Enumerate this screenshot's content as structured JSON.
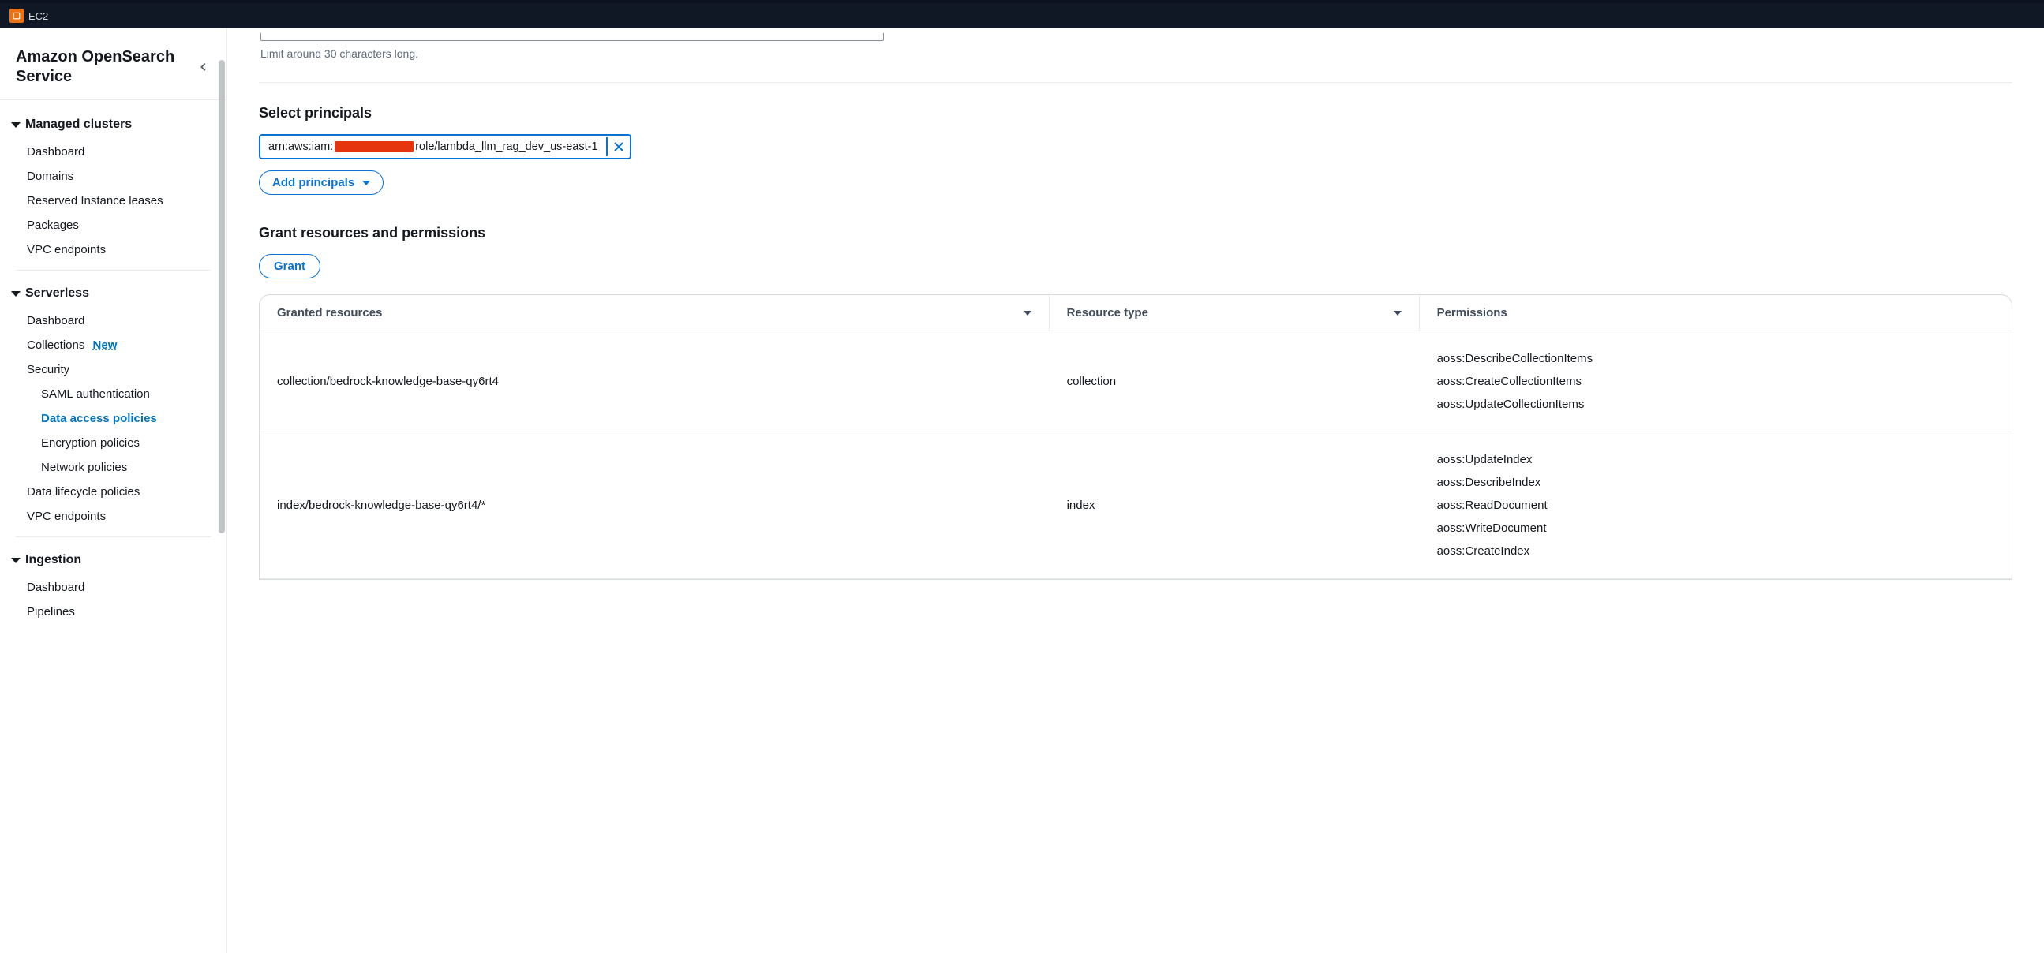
{
  "topbar": {
    "service_label": "EC2"
  },
  "sidebar": {
    "title": "Amazon OpenSearch Service",
    "groups": [
      {
        "label": "Managed clusters",
        "items": [
          {
            "label": "Dashboard"
          },
          {
            "label": "Domains"
          },
          {
            "label": "Reserved Instance leases"
          },
          {
            "label": "Packages"
          },
          {
            "label": "VPC endpoints"
          }
        ]
      },
      {
        "label": "Serverless",
        "items": [
          {
            "label": "Dashboard"
          },
          {
            "label": "Collections",
            "badge": "New"
          },
          {
            "label": "Security",
            "children": [
              {
                "label": "SAML authentication"
              },
              {
                "label": "Data access policies",
                "active": true
              },
              {
                "label": "Encryption policies"
              },
              {
                "label": "Network policies"
              }
            ]
          },
          {
            "label": "Data lifecycle policies"
          },
          {
            "label": "VPC endpoints"
          }
        ]
      },
      {
        "label": "Ingestion",
        "items": [
          {
            "label": "Dashboard"
          },
          {
            "label": "Pipelines"
          }
        ]
      }
    ]
  },
  "main": {
    "char_limit_hint": "Limit around 30 characters long.",
    "principals_heading": "Select principals",
    "principal_token_prefix": "arn:aws:iam:",
    "principal_token_suffix": "role/lambda_llm_rag_dev_us-east-1",
    "add_principals_label": "Add principals",
    "grant_heading": "Grant resources and permissions",
    "grant_btn_label": "Grant",
    "table": {
      "headers": {
        "resources": "Granted resources",
        "type": "Resource type",
        "perms": "Permissions"
      },
      "rows": [
        {
          "resource": "collection/bedrock-knowledge-base-qy6rt4",
          "type": "collection",
          "permissions": [
            "aoss:DescribeCollectionItems",
            "aoss:CreateCollectionItems",
            "aoss:UpdateCollectionItems"
          ]
        },
        {
          "resource": "index/bedrock-knowledge-base-qy6rt4/*",
          "type": "index",
          "permissions": [
            "aoss:UpdateIndex",
            "aoss:DescribeIndex",
            "aoss:ReadDocument",
            "aoss:WriteDocument",
            "aoss:CreateIndex"
          ]
        }
      ]
    }
  }
}
